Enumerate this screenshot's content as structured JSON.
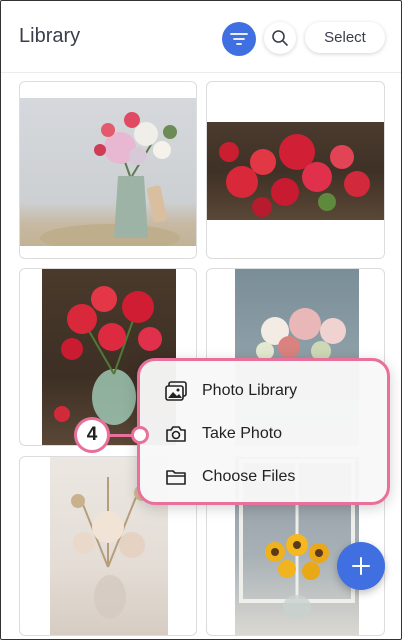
{
  "header": {
    "title": "Library",
    "select_label": "Select",
    "filter_icon": "filter-icon",
    "search_icon": "search-icon"
  },
  "photos": [
    {
      "name": "photo-pink-flowers-jug"
    },
    {
      "name": "photo-red-poppies-bouquet"
    },
    {
      "name": "photo-red-poppies-vase"
    },
    {
      "name": "photo-peonies-roses"
    },
    {
      "name": "photo-dried-flowers"
    },
    {
      "name": "photo-sunflowers-window"
    }
  ],
  "add_menu": {
    "items": [
      {
        "label": "Photo Library",
        "icon": "photo-library-icon"
      },
      {
        "label": "Take Photo",
        "icon": "camera-icon"
      },
      {
        "label": "Choose Files",
        "icon": "folder-icon"
      }
    ]
  },
  "step_badge": "4",
  "fab_icon": "plus-icon",
  "colors": {
    "accent": "#3f6fe0",
    "highlight": "#e8709a"
  }
}
